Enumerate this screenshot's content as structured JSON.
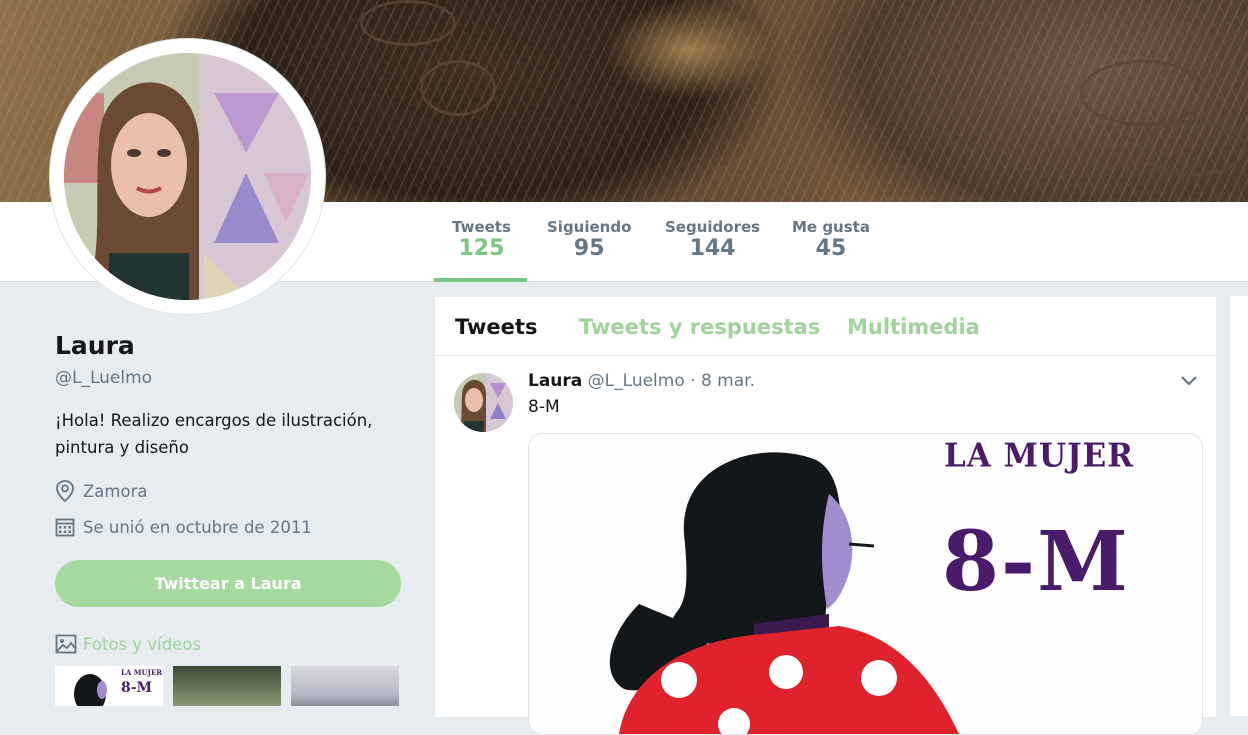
{
  "profile": {
    "name": "Laura",
    "handle": "@L_Luelmo",
    "bio": "¡Hola! Realizo encargos de ilustración, pintura y diseño",
    "location": "Zamora",
    "joined": "Se unió en octubre de 2011",
    "tweet_to_label": "Twittear a Laura",
    "photos_label": "Fotos y vídeos"
  },
  "stats": [
    {
      "label": "Tweets",
      "value": "125"
    },
    {
      "label": "Siguiendo",
      "value": "95"
    },
    {
      "label": "Seguidores",
      "value": "144"
    },
    {
      "label": "Me gusta",
      "value": "45"
    }
  ],
  "timeline": {
    "tabs": [
      "Tweets",
      "Tweets y respuestas",
      "Multimedia"
    ],
    "tweet": {
      "name": "Laura",
      "handle": "@L_Luelmo",
      "separator": "·",
      "date": "8 mar.",
      "text": "8-M",
      "media_line1": "LA MUJER",
      "media_line2": "8-M"
    }
  },
  "thumbnails": {
    "first_line1": "LA MUJER",
    "first_line2": "8-M"
  },
  "colors": {
    "accent": "#79c67e",
    "accent_light": "#a5da9f",
    "background": "#e6ecf0",
    "text_secondary": "#657786",
    "poster_purple": "#4a1a6b",
    "poster_red": "#e0222c"
  },
  "icons": [
    "location-pin-icon",
    "calendar-icon",
    "image-icon",
    "chevron-down-icon"
  ]
}
